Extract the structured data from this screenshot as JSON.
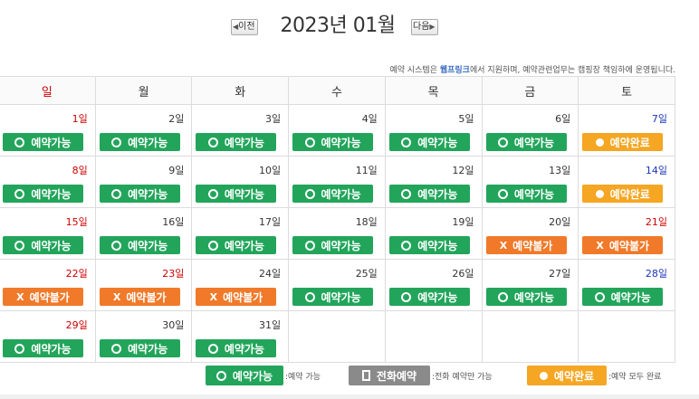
{
  "header": {
    "prev_label": "이전",
    "next_label": "다음",
    "month_title": "2023년 01월"
  },
  "notice": {
    "pre": "예약 시스템은 ",
    "brand": "웹프링크",
    "post": "에서 지원하며, 예약관련업무는 캠핑장 책임하에 운영됩니다."
  },
  "weekdays": [
    "일",
    "월",
    "화",
    "수",
    "목",
    "금",
    "토"
  ],
  "status_labels": {
    "avail": "예약가능",
    "done": "예약완료",
    "no": "예약불가",
    "phone": "전화예약"
  },
  "weeks": [
    [
      {
        "day": "1일",
        "status": "avail",
        "kind": "sun"
      },
      {
        "day": "2일",
        "status": "avail",
        "kind": "wd"
      },
      {
        "day": "3일",
        "status": "avail",
        "kind": "wd"
      },
      {
        "day": "4일",
        "status": "avail",
        "kind": "wd"
      },
      {
        "day": "5일",
        "status": "avail",
        "kind": "wd"
      },
      {
        "day": "6일",
        "status": "avail",
        "kind": "wd"
      },
      {
        "day": "7일",
        "status": "done",
        "kind": "sat"
      }
    ],
    [
      {
        "day": "8일",
        "status": "avail",
        "kind": "sun"
      },
      {
        "day": "9일",
        "status": "avail",
        "kind": "wd"
      },
      {
        "day": "10일",
        "status": "avail",
        "kind": "wd"
      },
      {
        "day": "11일",
        "status": "avail",
        "kind": "wd"
      },
      {
        "day": "12일",
        "status": "avail",
        "kind": "wd"
      },
      {
        "day": "13일",
        "status": "avail",
        "kind": "wd"
      },
      {
        "day": "14일",
        "status": "done",
        "kind": "sat"
      }
    ],
    [
      {
        "day": "15일",
        "status": "avail",
        "kind": "sun"
      },
      {
        "day": "16일",
        "status": "avail",
        "kind": "wd"
      },
      {
        "day": "17일",
        "status": "avail",
        "kind": "wd"
      },
      {
        "day": "18일",
        "status": "avail",
        "kind": "wd"
      },
      {
        "day": "19일",
        "status": "avail",
        "kind": "wd"
      },
      {
        "day": "20일",
        "status": "no",
        "kind": "wd"
      },
      {
        "day": "21일",
        "status": "no",
        "kind": "hol"
      }
    ],
    [
      {
        "day": "22일",
        "status": "no",
        "kind": "sun"
      },
      {
        "day": "23일",
        "status": "no",
        "kind": "hol"
      },
      {
        "day": "24일",
        "status": "no",
        "kind": "wd"
      },
      {
        "day": "25일",
        "status": "avail",
        "kind": "wd"
      },
      {
        "day": "26일",
        "status": "avail",
        "kind": "wd"
      },
      {
        "day": "27일",
        "status": "avail",
        "kind": "wd"
      },
      {
        "day": "28일",
        "status": "avail",
        "kind": "sat"
      }
    ],
    [
      {
        "day": "29일",
        "status": "avail",
        "kind": "sun"
      },
      {
        "day": "30일",
        "status": "avail",
        "kind": "wd"
      },
      {
        "day": "31일",
        "status": "avail",
        "kind": "wd"
      },
      null,
      null,
      null,
      null
    ]
  ],
  "legend": {
    "avail_text": ":예약 가능",
    "phone_text": ":전화 예약만 가능",
    "done_text": ":예약 모두 완료"
  },
  "colors": {
    "avail": "#22a55b",
    "done": "#f5a623",
    "no": "#f07a2a",
    "phone": "#8a8a8a",
    "sunday": "#cc0000",
    "saturday": "#1a35b8"
  }
}
